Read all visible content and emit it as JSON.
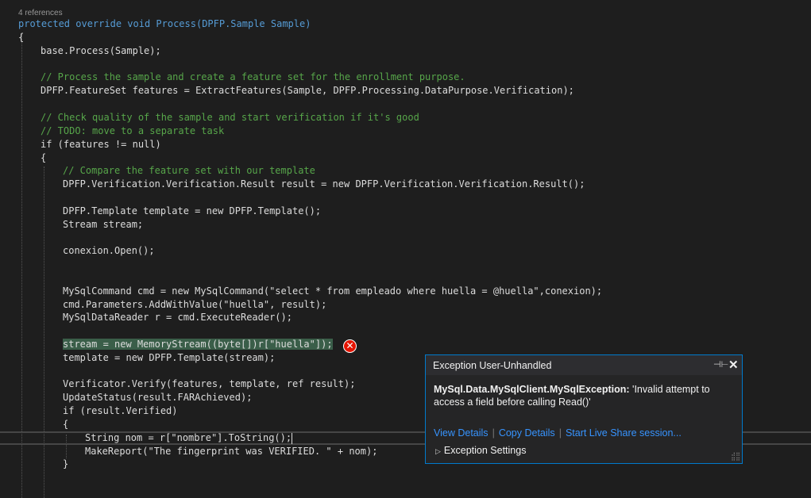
{
  "codelens": "4 references",
  "lines": [
    {
      "t": "protected override void Process(DPFP.Sample Sample)"
    },
    {
      "t": "{"
    },
    {
      "t": "base.Process(Sample);"
    },
    {
      "t": ""
    },
    {
      "t": "// Process the sample and create a feature set for the enrollment purpose."
    },
    {
      "t": "DPFP.FeatureSet features = ExtractFeatures(Sample, DPFP.Processing.DataPurpose.Verification);"
    },
    {
      "t": ""
    },
    {
      "t": "// Check quality of the sample and start verification if it's good"
    },
    {
      "t": "// TODO: move to a separate task"
    },
    {
      "t": "if (features != null)"
    },
    {
      "t": "{"
    },
    {
      "t": "// Compare the feature set with our template"
    },
    {
      "t": "DPFP.Verification.Verification.Result result = new DPFP.Verification.Verification.Result();"
    },
    {
      "t": ""
    },
    {
      "t": "DPFP.Template template = new DPFP.Template();"
    },
    {
      "t": "Stream stream;"
    },
    {
      "t": ""
    },
    {
      "t": "conexion.Open();"
    },
    {
      "t": ""
    },
    {
      "t": ""
    },
    {
      "t": "MySqlCommand cmd = new MySqlCommand(\"select * from empleado where huella = @huella\",conexion);"
    },
    {
      "t": "cmd.Parameters.AddWithValue(\"huella\", result);"
    },
    {
      "t": "MySqlDataReader r = cmd.ExecuteReader();"
    },
    {
      "t": ""
    },
    {
      "t": "stream = new MemoryStream((byte[])r[\"huella\"]);"
    },
    {
      "t": "template = new DPFP.Template(stream);"
    },
    {
      "t": ""
    },
    {
      "t": "Verificator.Verify(features, template, ref result);"
    },
    {
      "t": "UpdateStatus(result.FARAchieved);"
    },
    {
      "t": "if (result.Verified)"
    },
    {
      "t": "{"
    },
    {
      "t": "String nom = r[\"nombre\"].ToString();"
    },
    {
      "t": "MakeReport(\"The fingerprint was VERIFIED. \" + nom);"
    },
    {
      "t": "}"
    }
  ],
  "exception": {
    "title": "Exception User-Unhandled",
    "pin_icon": "pin-icon",
    "close_icon": "close-icon",
    "exception_type": "MySql.Data.MySqlClient.MySqlException:",
    "message": " 'Invalid attempt to access a field before calling Read()'",
    "links": [
      "View Details",
      "Copy Details",
      "Start Live Share session..."
    ],
    "settings_label": "Exception Settings"
  },
  "colors": {
    "background": "#1e1e1e",
    "keyword": "#569cd6",
    "type": "#4ec9b0",
    "method": "#dcdcaa",
    "string": "#d69d85",
    "comment": "#57a64a",
    "popup_border": "#007acc",
    "link": "#3794ff",
    "error_glyph": "#e51400"
  }
}
